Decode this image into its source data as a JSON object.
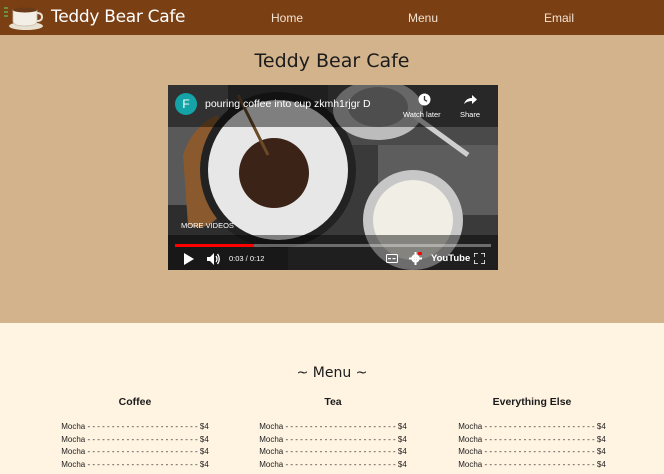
{
  "nav": {
    "brand": "Teddy Bear Cafe",
    "links": [
      "Home",
      "Menu",
      "Email"
    ]
  },
  "hero": {
    "title": "Teddy Bear Cafe",
    "video": {
      "channel_initial": "F",
      "title": "pouring coffee into cup zkmh1rjgr D",
      "watch_later": "Watch later",
      "share": "Share",
      "more_videos": "MORE VIDEOS",
      "time": "0:03 / 0:12",
      "progress": 0.25,
      "brand": "YouTube"
    }
  },
  "menu": {
    "title": "~ Menu ~",
    "columns": [
      {
        "heading": "Coffee",
        "items": [
          "Mocha - - - - - - - - - - - - - - - - - - - - - - - $4",
          "Mocha - - - - - - - - - - - - - - - - - - - - - - - $4",
          "Mocha - - - - - - - - - - - - - - - - - - - - - - - $4",
          "Mocha - - - - - - - - - - - - - - - - - - - - - - - $4"
        ]
      },
      {
        "heading": "Tea",
        "items": [
          "Mocha - - - - - - - - - - - - - - - - - - - - - - - $4",
          "Mocha - - - - - - - - - - - - - - - - - - - - - - - $4",
          "Mocha - - - - - - - - - - - - - - - - - - - - - - - $4",
          "Mocha - - - - - - - - - - - - - - - - - - - - - - - $4"
        ]
      },
      {
        "heading": "Everything Else",
        "items": [
          "Mocha - - - - - - - - - - - - - - - - - - - - - - - $4",
          "Mocha - - - - - - - - - - - - - - - - - - - - - - - $4",
          "Mocha - - - - - - - - - - - - - - - - - - - - - - - $4",
          "Mocha - - - - - - - - - - - - - - - - - - - - - - - $4"
        ]
      }
    ]
  },
  "colors": {
    "nav_bg": "#7b3f14",
    "hero_bg": "#d2b38c",
    "menu_bg": "#fff3e1",
    "progress": "#ff0000"
  }
}
